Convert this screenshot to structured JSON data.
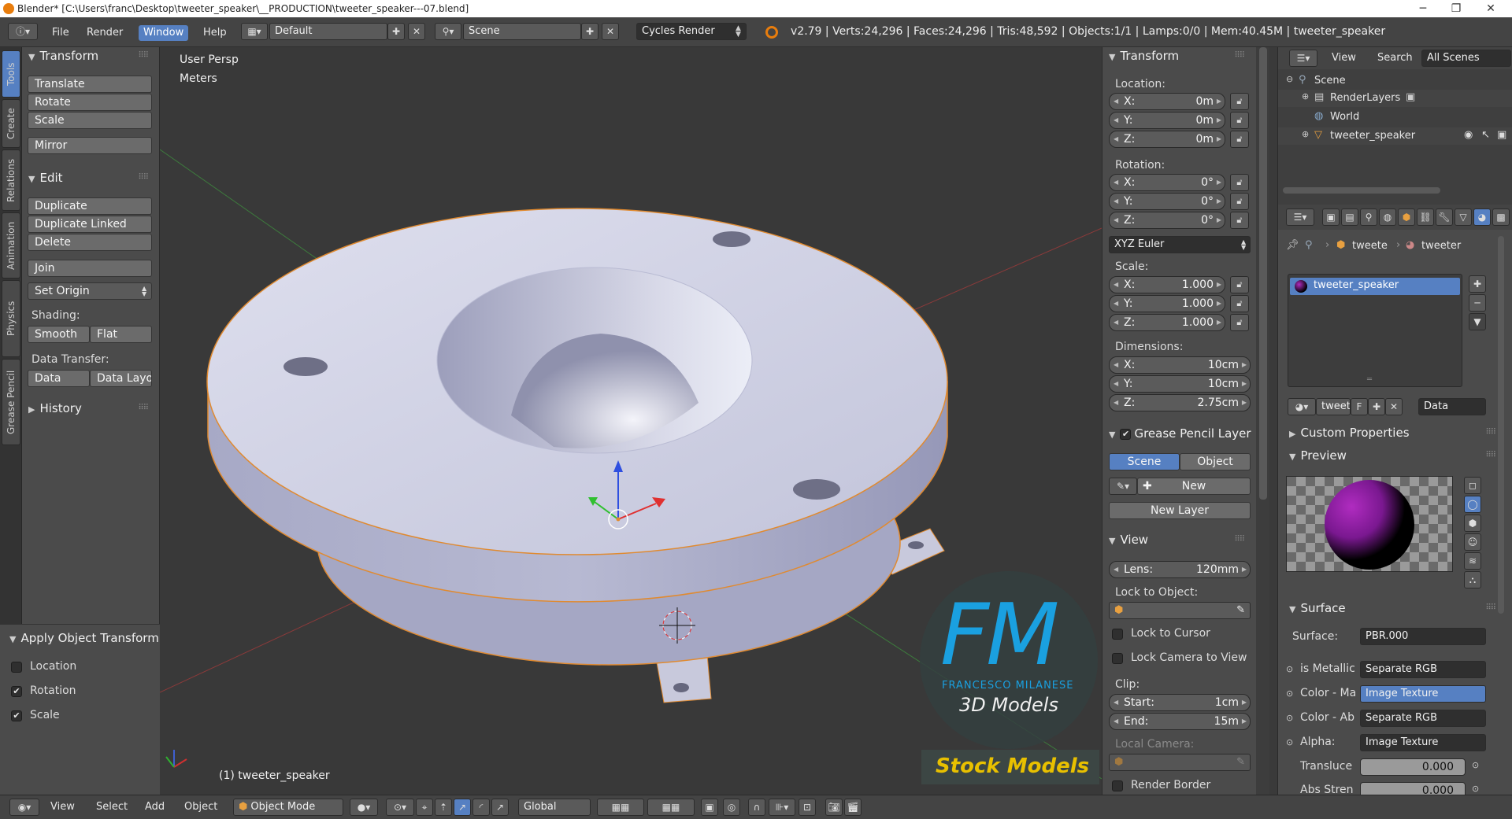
{
  "window": {
    "title": "Blender* [C:\\Users\\franc\\Desktop\\tweeter_speaker\\__PRODUCTION\\tweeter_speaker---07.blend]",
    "minimize": "─",
    "maximize": "❐",
    "close": "✕"
  },
  "header": {
    "menus": [
      "File",
      "Render",
      "Window",
      "Help"
    ],
    "layout": "Default",
    "scene": "Scene",
    "engine": "Cycles Render",
    "stats": "v2.79 | Verts:24,296 | Faces:24,296 | Tris:48,592 | Objects:1/1 | Lamps:0/0 | Mem:40.45M | tweeter_speaker"
  },
  "tool_tabs": [
    "Tools",
    "Create",
    "Relations",
    "Animation",
    "Physics",
    "Grease Pencil"
  ],
  "tools": {
    "transform_title": "Transform",
    "translate": "Translate",
    "rotate": "Rotate",
    "scale": "Scale",
    "mirror": "Mirror",
    "edit_title": "Edit",
    "duplicate": "Duplicate",
    "duplicate_linked": "Duplicate Linked",
    "delete": "Delete",
    "join": "Join",
    "set_origin": "Set Origin",
    "shading_label": "Shading:",
    "smooth": "Smooth",
    "flat": "Flat",
    "data_transfer_label": "Data Transfer:",
    "data": "Data",
    "data_layout": "Data Layo",
    "history_title": "History"
  },
  "operator": {
    "title": "Apply Object Transform",
    "location": "Location",
    "rotation": "Rotation",
    "scale": "Scale",
    "location_checked": false,
    "rotation_checked": true,
    "scale_checked": true
  },
  "viewport": {
    "view_name": "User Persp",
    "units": "Meters",
    "object_label": "(1) tweeter_speaker",
    "watermark_big": "FM",
    "watermark_name": "FRANCESCO MILANESE",
    "watermark_sub": "3D Models",
    "watermark_stock": "Stock Models"
  },
  "npanel": {
    "transform_title": "Transform",
    "location_label": "Location:",
    "location": [
      {
        "k": "X:",
        "v": "0m"
      },
      {
        "k": "Y:",
        "v": "0m"
      },
      {
        "k": "Z:",
        "v": "0m"
      }
    ],
    "rotation_label": "Rotation:",
    "rotation": [
      {
        "k": "X:",
        "v": "0°"
      },
      {
        "k": "Y:",
        "v": "0°"
      },
      {
        "k": "Z:",
        "v": "0°"
      }
    ],
    "rotation_mode": "XYZ Euler",
    "scale_label": "Scale:",
    "scale": [
      {
        "k": "X:",
        "v": "1.000"
      },
      {
        "k": "Y:",
        "v": "1.000"
      },
      {
        "k": "Z:",
        "v": "1.000"
      }
    ],
    "dimensions_label": "Dimensions:",
    "dimensions": [
      {
        "k": "X:",
        "v": "10cm"
      },
      {
        "k": "Y:",
        "v": "10cm"
      },
      {
        "k": "Z:",
        "v": "2.75cm"
      }
    ],
    "gp_title": "Grease Pencil Layer",
    "gp_scene": "Scene",
    "gp_object": "Object",
    "gp_new": "New",
    "gp_new_layer": "New Layer",
    "view_title": "View",
    "lens_k": "Lens:",
    "lens_v": "120mm",
    "lock_object_label": "Lock to Object:",
    "lock_cursor": "Lock to Cursor",
    "lock_camera": "Lock Camera to View",
    "clip_label": "Clip:",
    "clip_start_k": "Start:",
    "clip_start_v": "1cm",
    "clip_end_k": "End:",
    "clip_end_v": "15m",
    "local_camera_label": "Local Camera:",
    "render_border": "Render Border"
  },
  "outliner": {
    "view": "View",
    "search": "Search",
    "filter": "All Scenes",
    "items": [
      "Scene",
      "RenderLayers",
      "World",
      "tweeter_speaker"
    ]
  },
  "properties": {
    "crumb1": "tweete",
    "crumb2": "tweeter",
    "material_slot": "tweeter_speaker",
    "mat_name": "tweet",
    "mat_f": "F",
    "mat_link": "Data",
    "custom_props": "Custom Properties",
    "preview": "Preview",
    "surface_title": "Surface",
    "surface_label": "Surface:",
    "surface_value": "PBR.000",
    "rows": [
      {
        "k": "is Metallic",
        "v": "Separate RGB"
      },
      {
        "k": "Color - Ma",
        "v": "Image Texture"
      },
      {
        "k": "Color - Ab",
        "v": "Separate RGB"
      },
      {
        "k": "Alpha:",
        "v": "Image Texture"
      }
    ],
    "translucent_k": "Transluce",
    "translucent_v": "0.000",
    "abs_k": "Abs Stren",
    "abs_v": "0.000"
  },
  "bottombar": {
    "view": "View",
    "select": "Select",
    "add": "Add",
    "object": "Object",
    "mode": "Object Mode",
    "orientation": "Global"
  },
  "colors": {
    "accent": "#5680c2",
    "object_outline": "#e08a30",
    "material": "#b02cc0"
  }
}
